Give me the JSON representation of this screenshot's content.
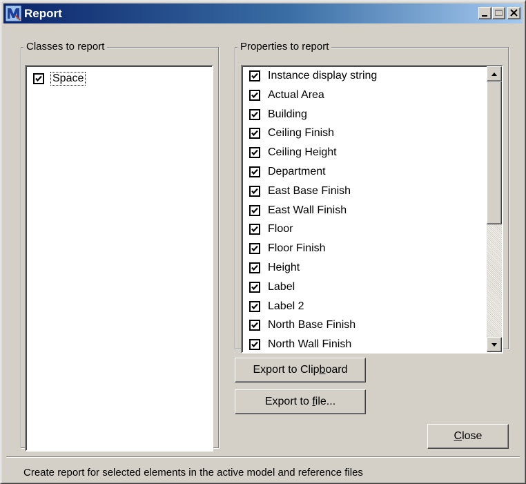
{
  "window": {
    "title": "Report",
    "app_icon": "microstation-icon"
  },
  "title_buttons": {
    "minimize": "minimize-icon",
    "maximize": "maximize-icon",
    "close": "close-icon"
  },
  "classes_group": {
    "legend": "Classes to report",
    "items": [
      {
        "label": "Space",
        "checked": true
      }
    ]
  },
  "properties_group": {
    "legend": "Properties to report",
    "items": [
      {
        "label": "Instance display string",
        "checked": true
      },
      {
        "label": "Actual Area",
        "checked": true
      },
      {
        "label": "Building",
        "checked": true
      },
      {
        "label": "Ceiling Finish",
        "checked": true
      },
      {
        "label": "Ceiling Height",
        "checked": true
      },
      {
        "label": "Department",
        "checked": true
      },
      {
        "label": "East Base Finish",
        "checked": true
      },
      {
        "label": "East Wall Finish",
        "checked": true
      },
      {
        "label": "Floor",
        "checked": true
      },
      {
        "label": "Floor Finish",
        "checked": true
      },
      {
        "label": "Height",
        "checked": true
      },
      {
        "label": "Label",
        "checked": true
      },
      {
        "label": "Label 2",
        "checked": true
      },
      {
        "label": "North Base Finish",
        "checked": true
      },
      {
        "label": "North Wall Finish",
        "checked": true
      }
    ]
  },
  "buttons": {
    "export_clipboard": {
      "pre": "Export to Clip",
      "mnemonic": "b",
      "post": "oard"
    },
    "export_file": {
      "pre": "Export to ",
      "mnemonic": "f",
      "post": "ile..."
    },
    "close": {
      "pre": "",
      "mnemonic": "C",
      "post": "lose"
    }
  },
  "status": "Create report for selected elements in the active model and reference files"
}
